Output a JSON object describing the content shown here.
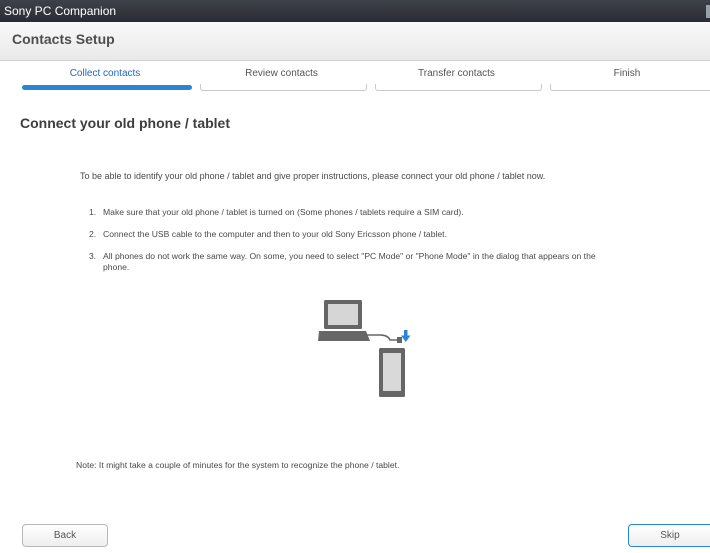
{
  "window": {
    "title": "Sony PC Companion"
  },
  "header": {
    "title": "Contacts Setup"
  },
  "steps": [
    {
      "label": "Collect contacts",
      "active": true
    },
    {
      "label": "Review contacts",
      "active": false
    },
    {
      "label": "Transfer contacts",
      "active": false
    },
    {
      "label": "Finish",
      "active": false
    }
  ],
  "main": {
    "title": "Connect your old phone / tablet",
    "intro": "To be able to identify your old phone / tablet and give proper instructions, please connect your old phone / tablet now.",
    "list": [
      {
        "num": "1.",
        "text": "Make sure that your old phone / tablet is turned on (Some phones / tablets require a SIM card)."
      },
      {
        "num": "2.",
        "text": "Connect the USB cable to the computer and then to your old Sony Ericsson phone / tablet."
      },
      {
        "num": "3.",
        "text": "All phones do not work the same way. On some, you need to select \"PC Mode\" or \"Phone Mode\" in the dialog that appears on the phone."
      }
    ],
    "illustration_icon": "laptop-usb-phone-icon",
    "note": "Note: It might take a couple of minutes for the system to recognize the phone / tablet."
  },
  "buttons": {
    "back": "Back",
    "skip": "Skip"
  },
  "colors": {
    "accent": "#2a86d4",
    "titlebar": "#2f3238"
  }
}
